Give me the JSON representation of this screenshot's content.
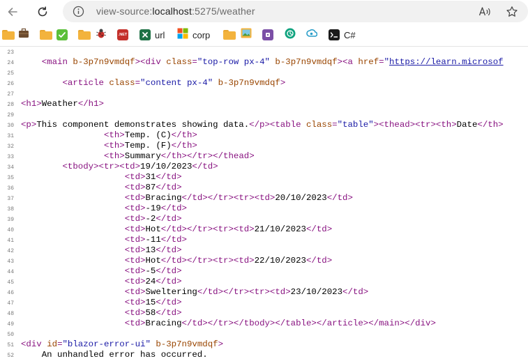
{
  "toolbar": {
    "url_scheme": "view-source:",
    "url_host": "localhost",
    "url_rest": ":5275/weather"
  },
  "bookmarks": [
    {
      "icon": "folder-icon",
      "label": ""
    },
    {
      "icon": "briefcase-icon",
      "label": ""
    },
    {
      "icon": "folder-icon",
      "label": ""
    },
    {
      "icon": "check-icon",
      "label": ""
    },
    {
      "icon": "folder-icon",
      "label": ""
    },
    {
      "icon": "bug-icon",
      "label": ""
    },
    {
      "icon": "dotnet-icon",
      "label": ".NET"
    },
    {
      "icon": "excel-icon",
      "label": "url"
    },
    {
      "icon": "microsoft-icon",
      "label": "corp"
    },
    {
      "icon": "folder-icon",
      "label": ""
    },
    {
      "icon": "image-icon",
      "label": ""
    },
    {
      "icon": "puzzle-icon",
      "label": ""
    },
    {
      "icon": "chatgpt-icon",
      "label": ""
    },
    {
      "icon": "cloud-icon",
      "label": ""
    },
    {
      "icon": "terminal-icon",
      "label": "C#"
    }
  ],
  "source": {
    "lines": [
      {
        "n": "23",
        "s": []
      },
      {
        "n": "24",
        "s": [
          {
            "c": "",
            "t": "    "
          },
          {
            "c": "t",
            "t": "<main "
          },
          {
            "c": "an",
            "t": "b-3p7n9vmdqf"
          },
          {
            "c": "t",
            "t": ">"
          },
          {
            "c": "t",
            "t": "<div "
          },
          {
            "c": "an",
            "t": "class"
          },
          {
            "c": "t",
            "t": "="
          },
          {
            "c": "av",
            "t": "\"top-row px-4\""
          },
          {
            "c": "t",
            "t": " "
          },
          {
            "c": "an",
            "t": "b-3p7n9vmdqf"
          },
          {
            "c": "t",
            "t": ">"
          },
          {
            "c": "t",
            "t": "<a "
          },
          {
            "c": "an",
            "t": "href"
          },
          {
            "c": "t",
            "t": "="
          },
          {
            "c": "av",
            "t": "\""
          },
          {
            "c": "lk",
            "t": "https://learn.microsof"
          }
        ]
      },
      {
        "n": "25",
        "s": []
      },
      {
        "n": "26",
        "s": [
          {
            "c": "",
            "t": "        "
          },
          {
            "c": "t",
            "t": "<article "
          },
          {
            "c": "an",
            "t": "class"
          },
          {
            "c": "t",
            "t": "="
          },
          {
            "c": "av",
            "t": "\"content px-4\""
          },
          {
            "c": "t",
            "t": " "
          },
          {
            "c": "an",
            "t": "b-3p7n9vmdqf"
          },
          {
            "c": "t",
            "t": ">"
          }
        ]
      },
      {
        "n": "27",
        "s": []
      },
      {
        "n": "28",
        "s": [
          {
            "c": "t",
            "t": "<h1>"
          },
          {
            "c": "",
            "t": "Weather"
          },
          {
            "c": "t",
            "t": "</h1>"
          }
        ]
      },
      {
        "n": "29",
        "s": []
      },
      {
        "n": "30",
        "s": [
          {
            "c": "t",
            "t": "<p>"
          },
          {
            "c": "",
            "t": "This component demonstrates showing data."
          },
          {
            "c": "t",
            "t": "</p>"
          },
          {
            "c": "t",
            "t": "<table "
          },
          {
            "c": "an",
            "t": "class"
          },
          {
            "c": "t",
            "t": "="
          },
          {
            "c": "av",
            "t": "\"table\""
          },
          {
            "c": "t",
            "t": ">"
          },
          {
            "c": "t",
            "t": "<thead><tr><th>"
          },
          {
            "c": "",
            "t": "Date"
          },
          {
            "c": "t",
            "t": "</th>"
          }
        ]
      },
      {
        "n": "31",
        "s": [
          {
            "c": "",
            "t": "                "
          },
          {
            "c": "t",
            "t": "<th>"
          },
          {
            "c": "",
            "t": "Temp. (C)"
          },
          {
            "c": "t",
            "t": "</th>"
          }
        ]
      },
      {
        "n": "32",
        "s": [
          {
            "c": "",
            "t": "                "
          },
          {
            "c": "t",
            "t": "<th>"
          },
          {
            "c": "",
            "t": "Temp. (F)"
          },
          {
            "c": "t",
            "t": "</th>"
          }
        ]
      },
      {
        "n": "33",
        "s": [
          {
            "c": "",
            "t": "                "
          },
          {
            "c": "t",
            "t": "<th>"
          },
          {
            "c": "",
            "t": "Summary"
          },
          {
            "c": "t",
            "t": "</th></tr></thead>"
          }
        ]
      },
      {
        "n": "34",
        "s": [
          {
            "c": "",
            "t": "        "
          },
          {
            "c": "t",
            "t": "<tbody><tr><td>"
          },
          {
            "c": "",
            "t": "19/10/2023"
          },
          {
            "c": "t",
            "t": "</td>"
          }
        ]
      },
      {
        "n": "35",
        "s": [
          {
            "c": "",
            "t": "                    "
          },
          {
            "c": "t",
            "t": "<td>"
          },
          {
            "c": "",
            "t": "31"
          },
          {
            "c": "t",
            "t": "</td>"
          }
        ]
      },
      {
        "n": "36",
        "s": [
          {
            "c": "",
            "t": "                    "
          },
          {
            "c": "t",
            "t": "<td>"
          },
          {
            "c": "",
            "t": "87"
          },
          {
            "c": "t",
            "t": "</td>"
          }
        ]
      },
      {
        "n": "37",
        "s": [
          {
            "c": "",
            "t": "                    "
          },
          {
            "c": "t",
            "t": "<td>"
          },
          {
            "c": "",
            "t": "Bracing"
          },
          {
            "c": "t",
            "t": "</td></tr><tr><td>"
          },
          {
            "c": "",
            "t": "20/10/2023"
          },
          {
            "c": "t",
            "t": "</td>"
          }
        ]
      },
      {
        "n": "38",
        "s": [
          {
            "c": "",
            "t": "                    "
          },
          {
            "c": "t",
            "t": "<td>"
          },
          {
            "c": "",
            "t": "-19"
          },
          {
            "c": "t",
            "t": "</td>"
          }
        ]
      },
      {
        "n": "39",
        "s": [
          {
            "c": "",
            "t": "                    "
          },
          {
            "c": "t",
            "t": "<td>"
          },
          {
            "c": "",
            "t": "-2"
          },
          {
            "c": "t",
            "t": "</td>"
          }
        ]
      },
      {
        "n": "40",
        "s": [
          {
            "c": "",
            "t": "                    "
          },
          {
            "c": "t",
            "t": "<td>"
          },
          {
            "c": "",
            "t": "Hot"
          },
          {
            "c": "t",
            "t": "</td></tr><tr><td>"
          },
          {
            "c": "",
            "t": "21/10/2023"
          },
          {
            "c": "t",
            "t": "</td>"
          }
        ]
      },
      {
        "n": "41",
        "s": [
          {
            "c": "",
            "t": "                    "
          },
          {
            "c": "t",
            "t": "<td>"
          },
          {
            "c": "",
            "t": "-11"
          },
          {
            "c": "t",
            "t": "</td>"
          }
        ]
      },
      {
        "n": "42",
        "s": [
          {
            "c": "",
            "t": "                    "
          },
          {
            "c": "t",
            "t": "<td>"
          },
          {
            "c": "",
            "t": "13"
          },
          {
            "c": "t",
            "t": "</td>"
          }
        ]
      },
      {
        "n": "43",
        "s": [
          {
            "c": "",
            "t": "                    "
          },
          {
            "c": "t",
            "t": "<td>"
          },
          {
            "c": "",
            "t": "Hot"
          },
          {
            "c": "t",
            "t": "</td></tr><tr><td>"
          },
          {
            "c": "",
            "t": "22/10/2023"
          },
          {
            "c": "t",
            "t": "</td>"
          }
        ]
      },
      {
        "n": "44",
        "s": [
          {
            "c": "",
            "t": "                    "
          },
          {
            "c": "t",
            "t": "<td>"
          },
          {
            "c": "",
            "t": "-5"
          },
          {
            "c": "t",
            "t": "</td>"
          }
        ]
      },
      {
        "n": "45",
        "s": [
          {
            "c": "",
            "t": "                    "
          },
          {
            "c": "t",
            "t": "<td>"
          },
          {
            "c": "",
            "t": "24"
          },
          {
            "c": "t",
            "t": "</td>"
          }
        ]
      },
      {
        "n": "46",
        "s": [
          {
            "c": "",
            "t": "                    "
          },
          {
            "c": "t",
            "t": "<td>"
          },
          {
            "c": "",
            "t": "Sweltering"
          },
          {
            "c": "t",
            "t": "</td></tr><tr><td>"
          },
          {
            "c": "",
            "t": "23/10/2023"
          },
          {
            "c": "t",
            "t": "</td>"
          }
        ]
      },
      {
        "n": "47",
        "s": [
          {
            "c": "",
            "t": "                    "
          },
          {
            "c": "t",
            "t": "<td>"
          },
          {
            "c": "",
            "t": "15"
          },
          {
            "c": "t",
            "t": "</td>"
          }
        ]
      },
      {
        "n": "48",
        "s": [
          {
            "c": "",
            "t": "                    "
          },
          {
            "c": "t",
            "t": "<td>"
          },
          {
            "c": "",
            "t": "58"
          },
          {
            "c": "t",
            "t": "</td>"
          }
        ]
      },
      {
        "n": "49",
        "s": [
          {
            "c": "",
            "t": "                    "
          },
          {
            "c": "t",
            "t": "<td>"
          },
          {
            "c": "",
            "t": "Bracing"
          },
          {
            "c": "t",
            "t": "</td></tr></tbody></table></article></main></div>"
          }
        ]
      },
      {
        "n": "50",
        "s": []
      },
      {
        "n": "51",
        "s": [
          {
            "c": "t",
            "t": "<div "
          },
          {
            "c": "an",
            "t": "id"
          },
          {
            "c": "t",
            "t": "="
          },
          {
            "c": "av",
            "t": "\"blazor-error-ui\""
          },
          {
            "c": "t",
            "t": " "
          },
          {
            "c": "an",
            "t": "b-3p7n9vmdqf"
          },
          {
            "c": "t",
            "t": ">"
          }
        ]
      },
      {
        "n": "52",
        "s": [
          {
            "c": "",
            "t": "    An unhandled error has occurred."
          }
        ]
      }
    ]
  }
}
